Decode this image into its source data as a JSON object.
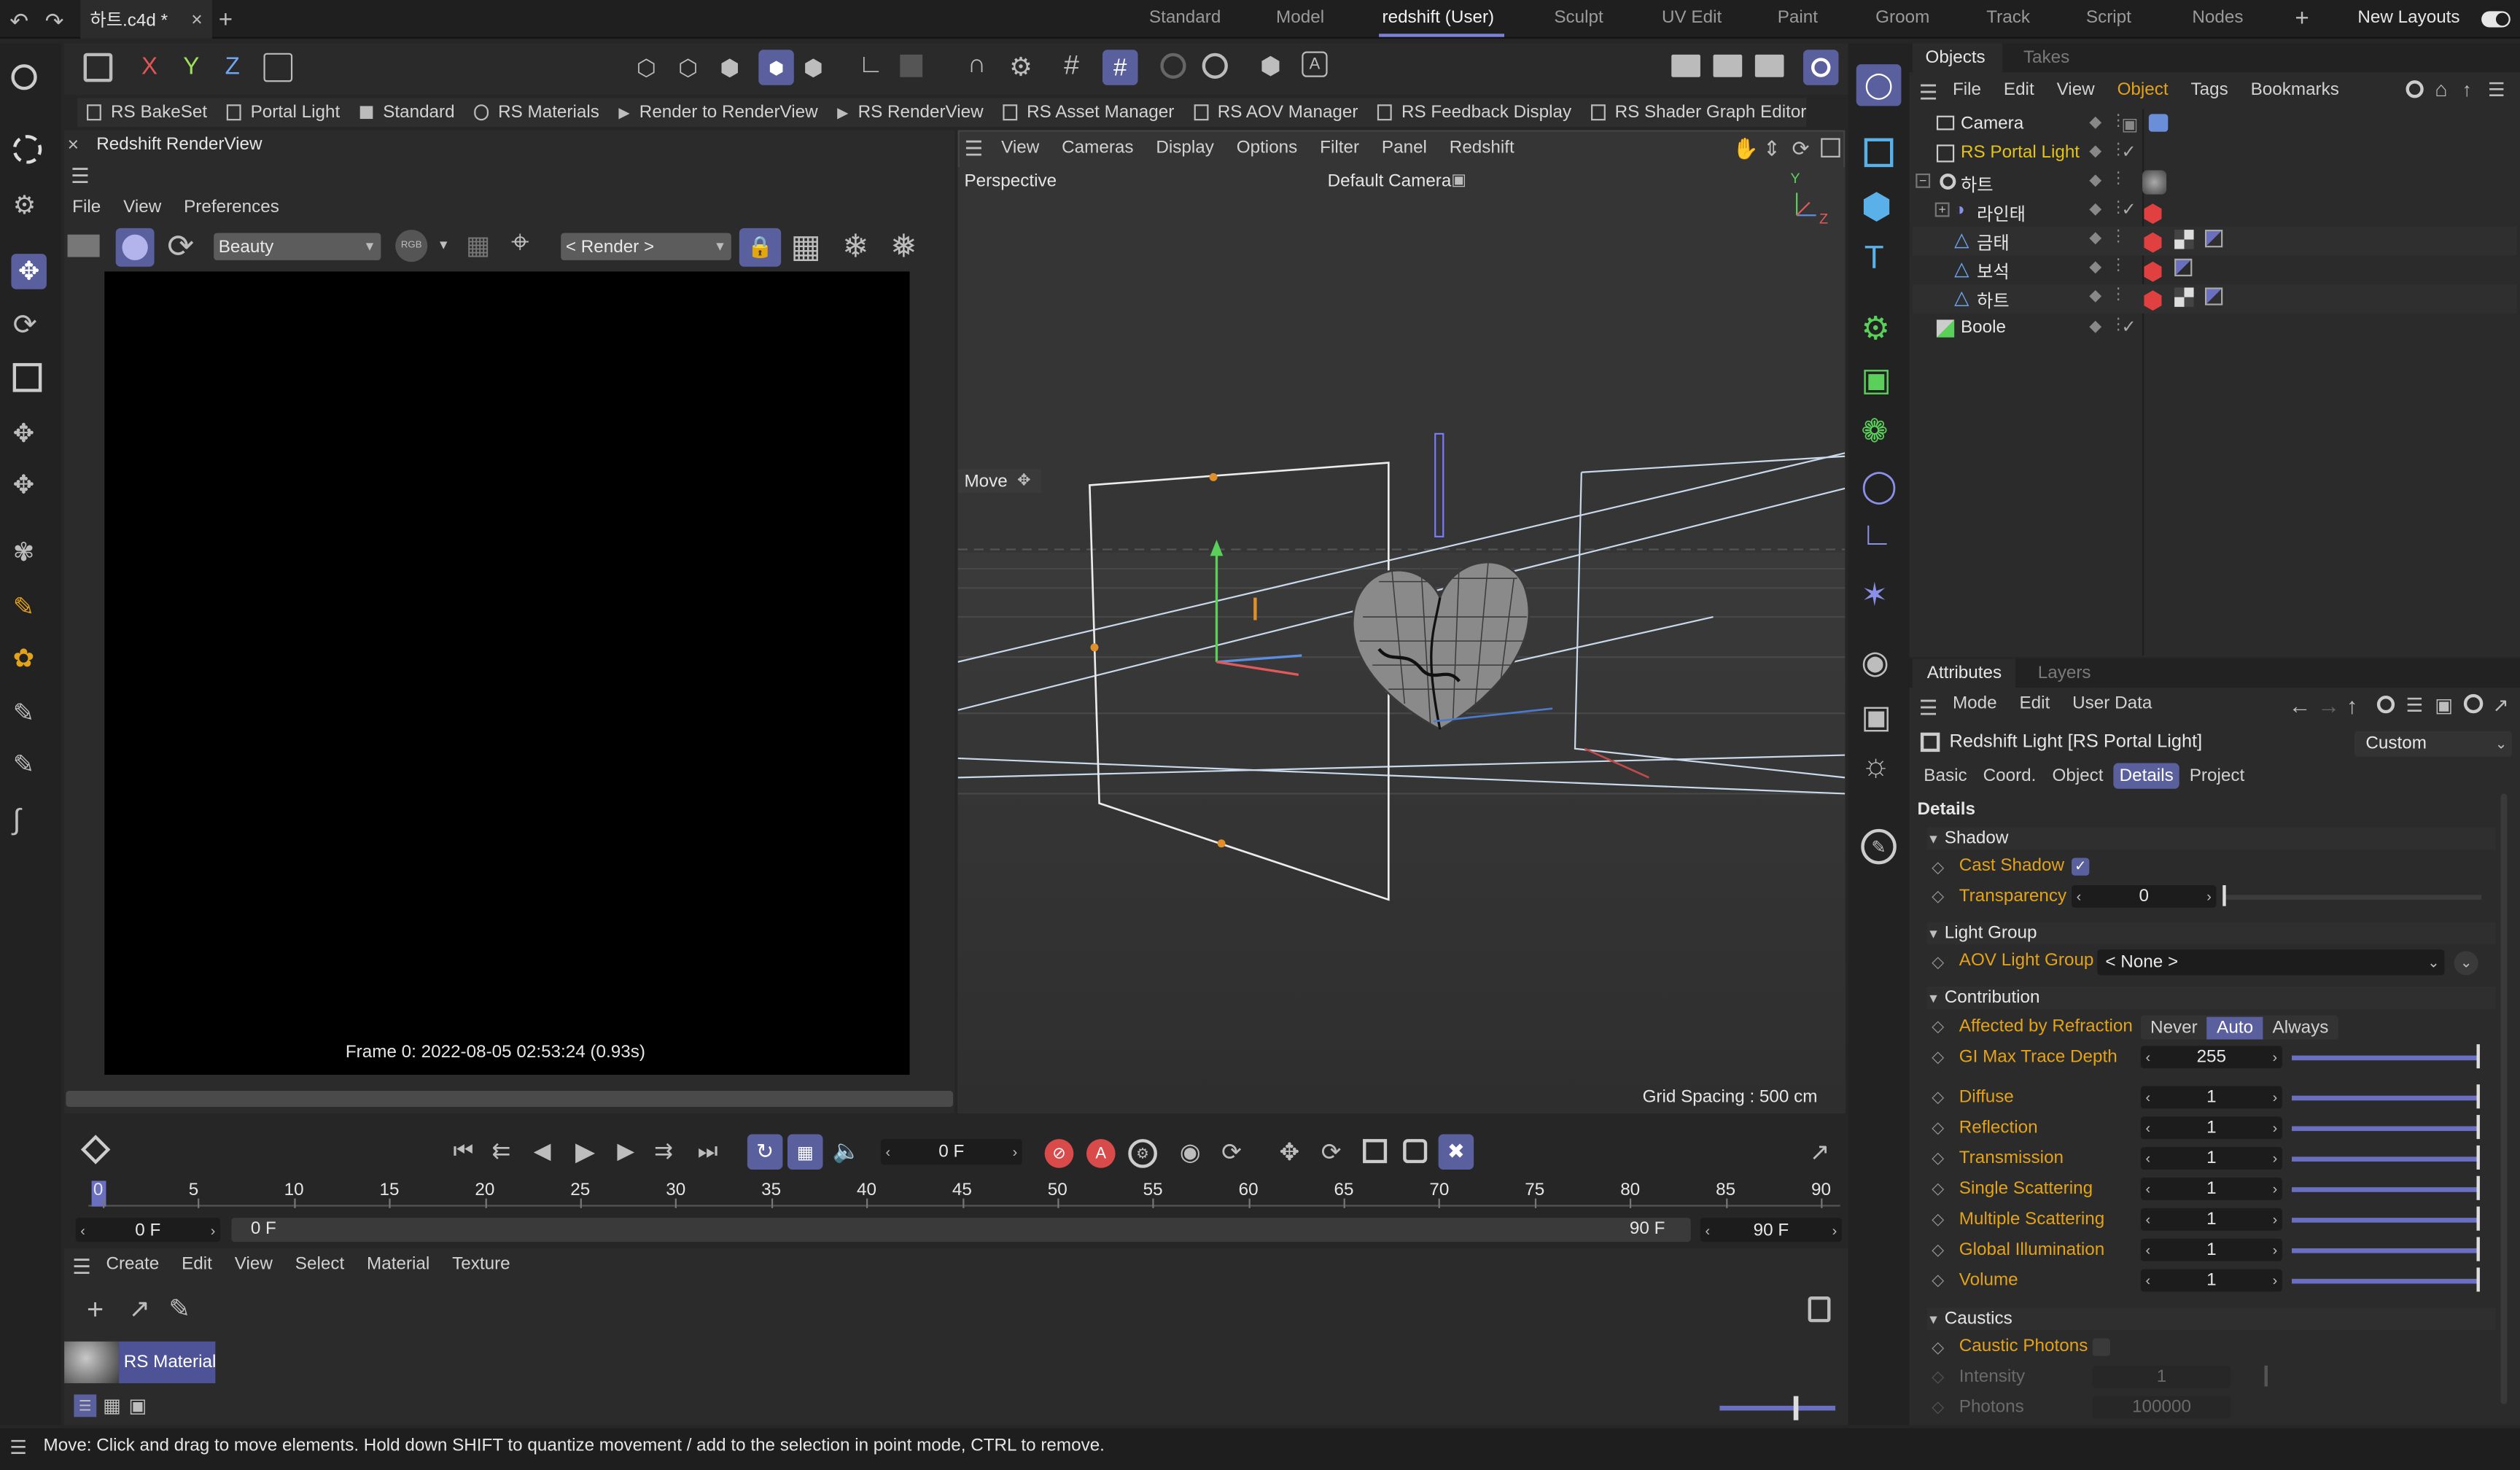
{
  "titlebar": {
    "doc_tab": "하트.c4d *",
    "layouts": [
      "Standard",
      "Model",
      "redshift (User)",
      "Sculpt",
      "UV Edit",
      "Paint",
      "Groom",
      "Track",
      "Script",
      "Nodes"
    ],
    "active_layout": "redshift (User)",
    "plus": "+",
    "new_layouts": "New Layouts"
  },
  "toolbar": {
    "axes": [
      "X",
      "Y",
      "Z"
    ],
    "rs_items": [
      "RS BakeSet",
      "Portal Light",
      "Standard",
      "RS Materials",
      "Render to RenderView",
      "RS RenderView",
      "RS Asset Manager",
      "RS AOV Manager",
      "RS Feedback Display",
      "RS Shader Graph Editor"
    ]
  },
  "renderview": {
    "title": "Redshift RenderView",
    "menu": [
      "File",
      "View",
      "Preferences"
    ],
    "aov": "Beauty",
    "rgb": "RGB",
    "render_mode": "< Render >",
    "frame_info": "Frame 0:  2022-08-05  02:53:24  (0.93s)"
  },
  "viewport": {
    "menu": [
      "View",
      "Cameras",
      "Display",
      "Options",
      "Filter",
      "Panel",
      "Redshift"
    ],
    "projection": "Perspective",
    "camera": "Default Camera",
    "tool_hint": "Move",
    "grid_spacing": "Grid Spacing : 500 cm",
    "axis_y": "Y",
    "axis_z": "Z"
  },
  "timeline": {
    "frame_field": "0 F",
    "ticks": [
      "0",
      "5",
      "10",
      "15",
      "20",
      "25",
      "30",
      "35",
      "40",
      "45",
      "50",
      "55",
      "60",
      "65",
      "70",
      "75",
      "80",
      "85",
      "90"
    ],
    "start": "0 F",
    "range_start": "0 F",
    "range_end": "90 F",
    "end": "90 F"
  },
  "materials": {
    "menu": [
      "Create",
      "Edit",
      "View",
      "Select",
      "Material",
      "Texture"
    ],
    "item": "RS Material"
  },
  "status": {
    "text": "Move: Click and drag to move elements. Hold down SHIFT to quantize movement / add to the selection in point mode, CTRL to remove."
  },
  "objects": {
    "tabs": [
      "Objects",
      "Takes"
    ],
    "menu": [
      "File",
      "Edit",
      "View",
      "Object",
      "Tags",
      "Bookmarks"
    ],
    "active_menu": "Object",
    "items": [
      {
        "name": "Camera",
        "indent": 0,
        "highlight": false
      },
      {
        "name": "RS Portal Light",
        "indent": 0,
        "highlight": true
      },
      {
        "name": "하트",
        "indent": 0,
        "highlight": false
      },
      {
        "name": "라인태",
        "indent": 1,
        "highlight": false
      },
      {
        "name": "금태",
        "indent": 2,
        "highlight": false
      },
      {
        "name": "보석",
        "indent": 2,
        "highlight": false
      },
      {
        "name": "하트",
        "indent": 2,
        "highlight": false
      },
      {
        "name": "Boole",
        "indent": 0,
        "highlight": false
      }
    ]
  },
  "attributes": {
    "tabs": [
      "Attributes",
      "Layers"
    ],
    "menu": [
      "Mode",
      "Edit",
      "User Data"
    ],
    "object_title": "Redshift Light [RS Portal Light]",
    "preset": "Custom",
    "subtabs": [
      "Basic",
      "Coord.",
      "Object",
      "Details",
      "Project"
    ],
    "active_subtab": "Details",
    "section": "Details",
    "shadow": {
      "header": "Shadow",
      "cast_shadow": "Cast Shadow",
      "transparency": "Transparency",
      "transparency_value": "0"
    },
    "light_group": {
      "header": "Light Group",
      "label": "AOV Light Group",
      "value": "< None >"
    },
    "contribution": {
      "header": "Contribution",
      "refraction_label": "Affected by Refraction",
      "refraction_options": [
        "Never",
        "Auto",
        "Always"
      ],
      "refraction_selected": "Auto",
      "gi_label": "GI Max Trace Depth",
      "gi_value": "255",
      "rows": [
        {
          "label": "Diffuse",
          "value": "1"
        },
        {
          "label": "Reflection",
          "value": "1"
        },
        {
          "label": "Transmission",
          "value": "1"
        },
        {
          "label": "Single Scattering",
          "value": "1"
        },
        {
          "label": "Multiple Scattering",
          "value": "1"
        },
        {
          "label": "Global Illumination",
          "value": "1"
        },
        {
          "label": "Volume",
          "value": "1"
        }
      ]
    },
    "caustics": {
      "header": "Caustics",
      "caustic_photons": "Caustic Photons",
      "intensity": "Intensity",
      "intensity_value": "1",
      "photons": "Photons",
      "photons_value": "100000"
    }
  },
  "colors": {
    "accent": "#5a5f9e",
    "label_orange": "#e2a21b",
    "bg": "#262626"
  }
}
